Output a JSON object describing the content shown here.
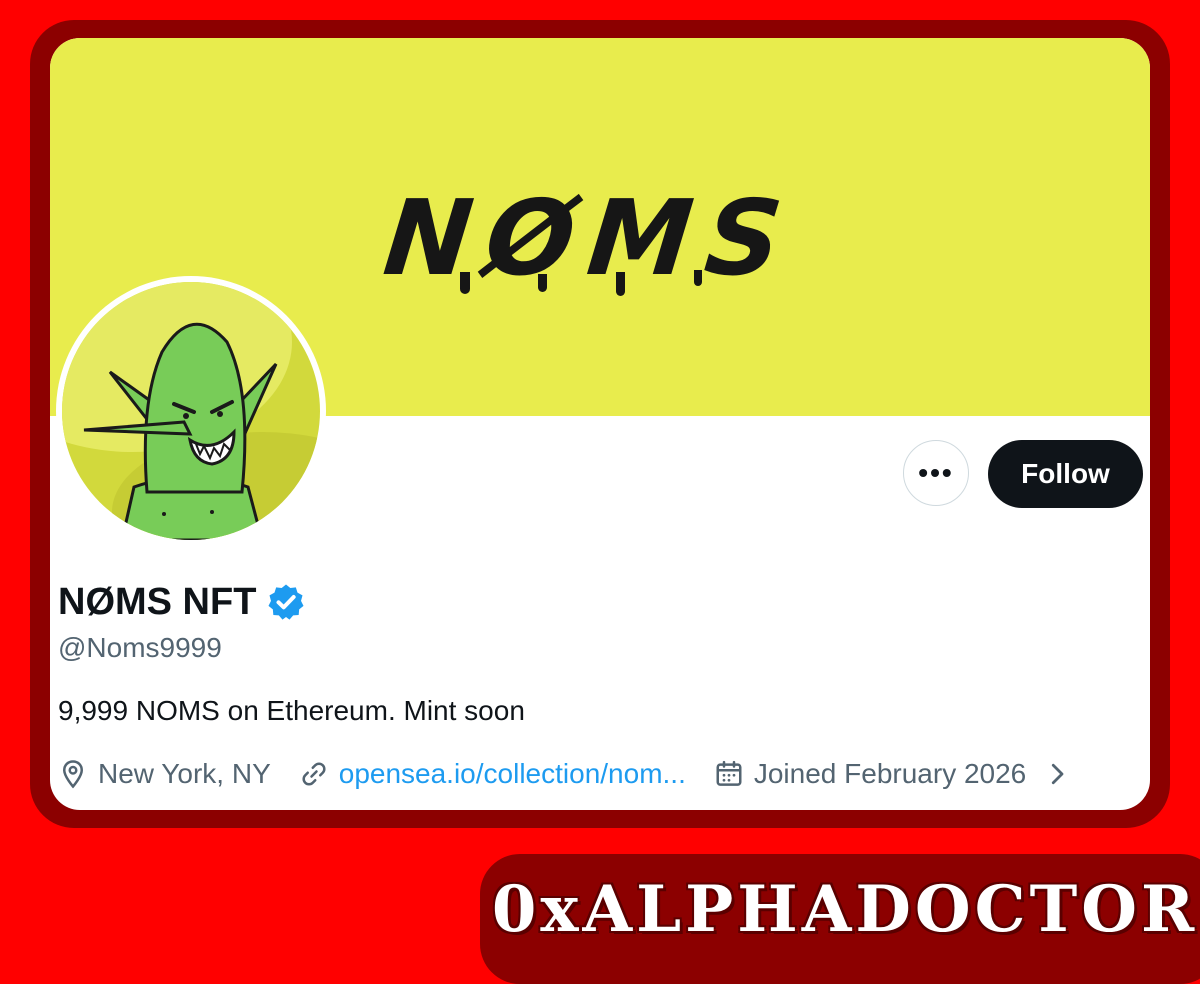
{
  "banner": {
    "logo_text": "NØMS"
  },
  "profile": {
    "name": "NØMS NFT",
    "handle": "@Noms9999",
    "bio": "9,999 NOMS on Ethereum. Mint soon",
    "location": "New York, NY",
    "link": "opensea.io/collection/nom...",
    "joined": "Joined February 2026",
    "verified": true
  },
  "actions": {
    "more_label": "•••",
    "follow_label": "Follow"
  },
  "icons": {
    "location": "location-pin-icon",
    "link": "link-icon",
    "calendar": "calendar-icon",
    "chevron": "chevron-right-icon",
    "verified": "verified-badge-icon"
  },
  "colors": {
    "banner": "#e8ec4d",
    "follow_button": "#0f1419",
    "verified": "#1d9bf0",
    "link": "#1d9bf0",
    "frame": "#8c0000",
    "background": "#ff0000"
  },
  "watermark": {
    "text": "0xALPHADOCTOR"
  }
}
